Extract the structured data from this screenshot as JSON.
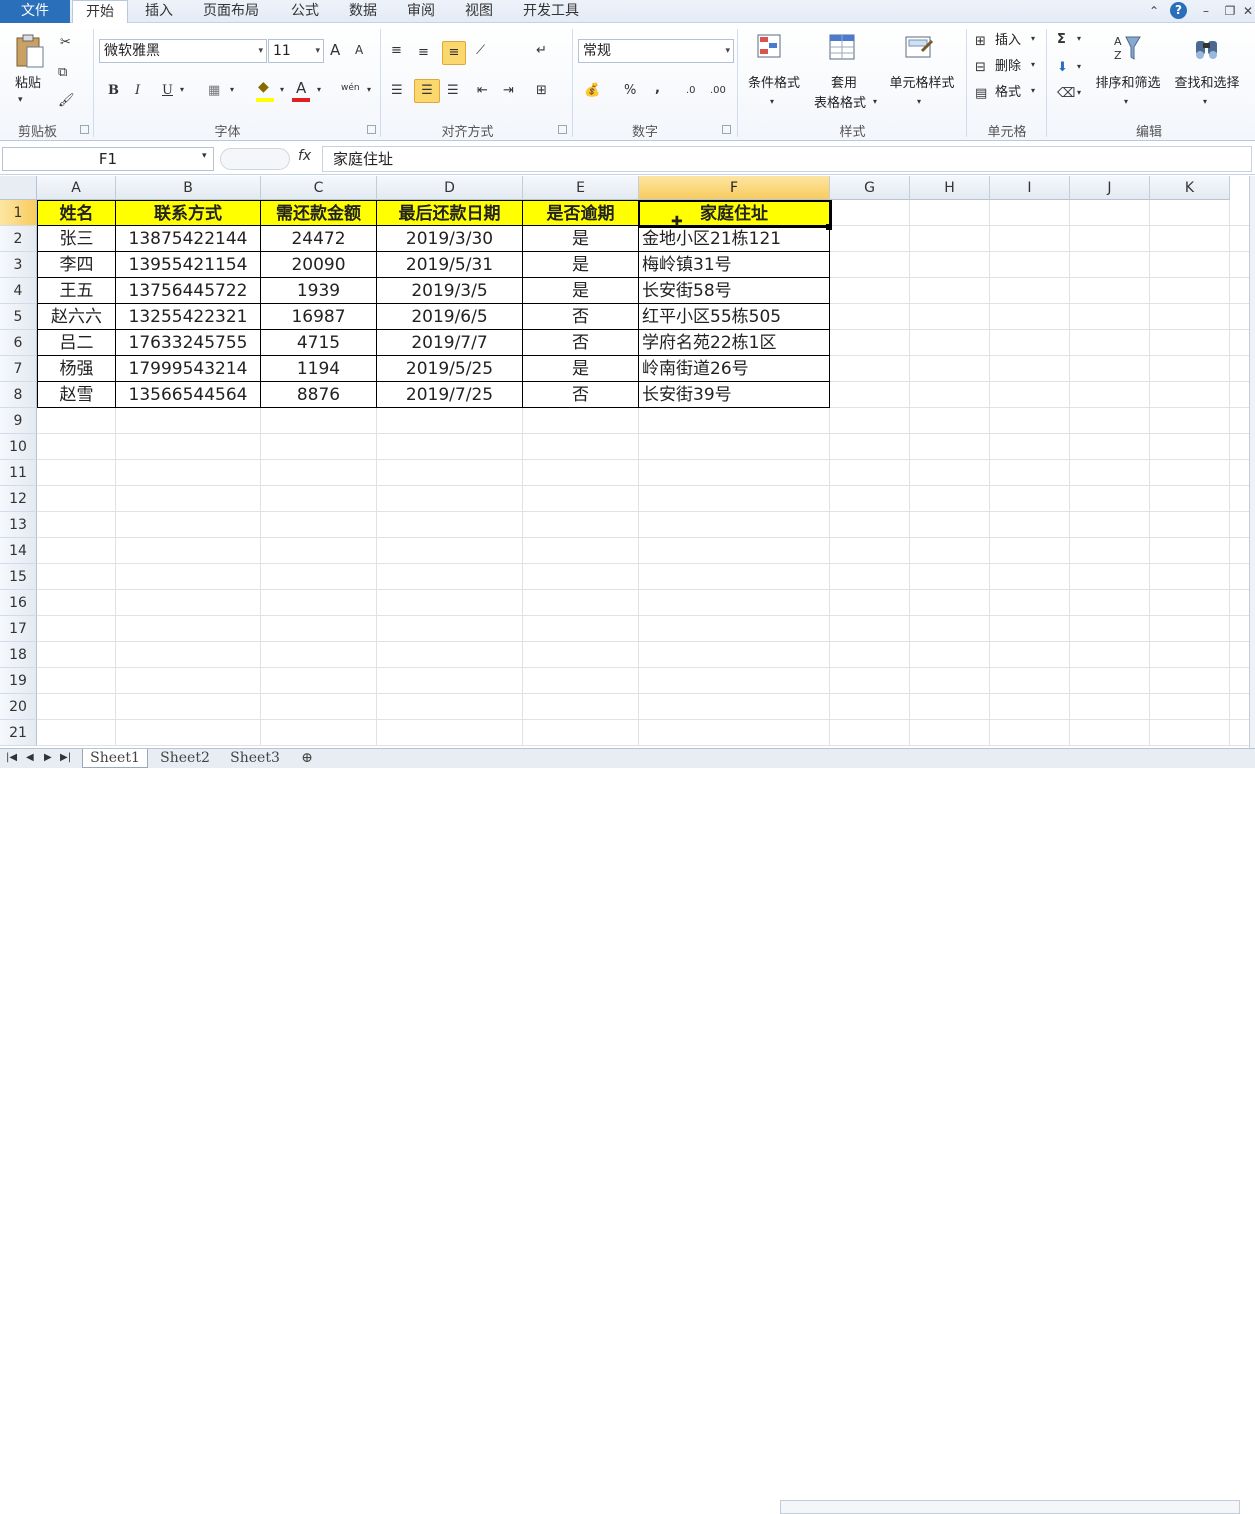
{
  "menu": {
    "file": "文件",
    "tabs": [
      "开始",
      "插入",
      "页面布局",
      "公式",
      "数据",
      "审阅",
      "视图",
      "开发工具"
    ]
  },
  "ribbon": {
    "clipboard": {
      "paste": "粘贴",
      "label": "剪贴板"
    },
    "font": {
      "name": "微软雅黑",
      "size": "11",
      "label": "字体",
      "bold": "B",
      "italic": "I",
      "underline": "U",
      "grow": "A",
      "shrink": "A",
      "fill_icon": "◆",
      "color_icon": "A",
      "phonetic": "wén"
    },
    "alignment": {
      "label": "对齐方式"
    },
    "number": {
      "format": "常规",
      "label": "数字",
      "percent": "%",
      "comma": ",",
      "inc_dec": ".0",
      "dec_dec": ".00"
    },
    "styles": {
      "conditional": "条件格式",
      "table_1": "套用",
      "table_2": "表格格式",
      "cell_styles": "单元格样式",
      "label": "样式"
    },
    "cells": {
      "insert": "插入",
      "delete": "删除",
      "format": "格式",
      "label": "单元格"
    },
    "editing": {
      "sigma": "Σ",
      "sort": "排序和筛选",
      "find": "查找和选择",
      "label": "编辑"
    }
  },
  "formula_bar": {
    "name_box": "F1",
    "fx": "fx",
    "content": "家庭住址"
  },
  "columns": [
    "A",
    "B",
    "C",
    "D",
    "E",
    "F",
    "G",
    "H",
    "I",
    "J",
    "K"
  ],
  "rows": [
    "1",
    "2",
    "3",
    "4",
    "5",
    "6",
    "7",
    "8",
    "9",
    "10",
    "11",
    "12",
    "13",
    "14",
    "15",
    "16",
    "17",
    "18",
    "19",
    "20",
    "21"
  ],
  "table": {
    "headers": [
      "姓名",
      "联系方式",
      "需还款金额",
      "最后还款日期",
      "是否逾期",
      "家庭住址"
    ],
    "data": [
      [
        "张三",
        "13875422144",
        "24472",
        "2019/3/30",
        "是",
        "金地小区21栋121"
      ],
      [
        "李四",
        "13955421154",
        "20090",
        "2019/5/31",
        "是",
        "梅岭镇31号"
      ],
      [
        "王五",
        "13756445722",
        "1939",
        "2019/3/5",
        "是",
        "长安街58号"
      ],
      [
        "赵六六",
        "13255422321",
        "16987",
        "2019/6/5",
        "否",
        "红平小区55栋505"
      ],
      [
        "吕二",
        "17633245755",
        "4715",
        "2019/7/7",
        "否",
        "学府名苑22栋1区"
      ],
      [
        "杨强",
        "17999543214",
        "1194",
        "2019/5/25",
        "是",
        "岭南街道26号"
      ],
      [
        "赵雪",
        "13566544564",
        "8876",
        "2019/7/25",
        "否",
        "长安街39号"
      ]
    ]
  },
  "sheets": [
    "Sheet1",
    "Sheet2",
    "Sheet3"
  ],
  "colors": {
    "header_fill": "#ffff00",
    "accent": "#2a6fb9",
    "selected_header": "#f8cc5e"
  }
}
